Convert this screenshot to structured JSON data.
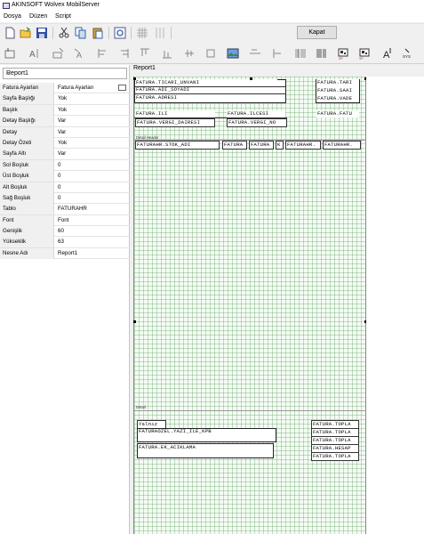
{
  "window": {
    "title": "AKINSOFT Wolvex MobilServer"
  },
  "menu": [
    "Dosya",
    "Düzen",
    "Script"
  ],
  "toolbar": {
    "close_label": "Kapat",
    "icons": [
      "new-icon",
      "open-icon",
      "save-icon",
      "cut-icon",
      "copy-icon",
      "paste-icon",
      "preview-icon",
      "grid-icon",
      "snap-icon"
    ],
    "row2_icons": [
      "select-icon",
      "text-tool-icon",
      "field-tool-icon",
      "label-tool-icon",
      "align-left-icon",
      "align-right-icon",
      "align-top-icon",
      "align-bottom-icon",
      "image-tool-icon",
      "hline-tool-icon",
      "vline-tool-icon",
      "barcode-icon",
      "barcode-color-icon",
      "qr-icon",
      "qr-color-icon",
      "font-size-icon",
      "sys-var-icon"
    ]
  },
  "left_panel": {
    "report_select": "Report1",
    "properties": [
      {
        "key": "Fatura Ayarları",
        "value": "Fatura Ayarları",
        "checkbox": true
      },
      {
        "key": "Sayfa Başlığı",
        "value": "Yok"
      },
      {
        "key": "Başlık",
        "value": "Yok"
      },
      {
        "key": "Detay Başlığı",
        "value": "Var"
      },
      {
        "key": "Detay",
        "value": "Var"
      },
      {
        "key": "Detay Özeti",
        "value": "Yok"
      },
      {
        "key": "Sayfa Altı",
        "value": "Var"
      },
      {
        "key": "Sol Boşluk",
        "value": "0"
      },
      {
        "key": "Üst Boşluk",
        "value": "0"
      },
      {
        "key": "Alt Boşluk",
        "value": "0"
      },
      {
        "key": "Sağ Boşluk",
        "value": "0"
      },
      {
        "key": "Tablo",
        "value": "FATURAHR"
      },
      {
        "key": "Font",
        "value": "Font"
      },
      {
        "key": "Genişlik",
        "value": "60"
      },
      {
        "key": "Yükseklik",
        "value": "63"
      },
      {
        "key": "Nesne Adı",
        "value": "Report1"
      }
    ]
  },
  "designer": {
    "report_name": "Report1",
    "band_detail_header": "Detail Header",
    "band_footer": "Detail",
    "header_fields": [
      "FATURA.TICARI_UNVANI",
      "FATURA.ADI_SOYADI",
      "FATURA.ADRESI",
      "FATURA.ILI",
      "FATURA.ILCESI",
      "FATURA.VERGI_DAIRESI",
      "FATURA.VERGI_NO",
      "FATURA.TARI",
      "FATURA.SAAI",
      "FATURA.VADE",
      "FATURA.FATU"
    ],
    "detail_fields": [
      "FATURAHR.STOK_ADI",
      "FATURA",
      "FATURA",
      "K",
      "FATURAHR.",
      "FATURAHR."
    ],
    "footer_fields": [
      "Yalnız",
      "FATURAOZEL.YAZI_ILE_KPB",
      "FATURA.EK_ACIKLAMA",
      "FATURA.TOPLA",
      "FATURA.TOPLA",
      "FATURA.TOPLA",
      "FATURA.HESAP",
      "FATURA.TOPLA"
    ]
  }
}
